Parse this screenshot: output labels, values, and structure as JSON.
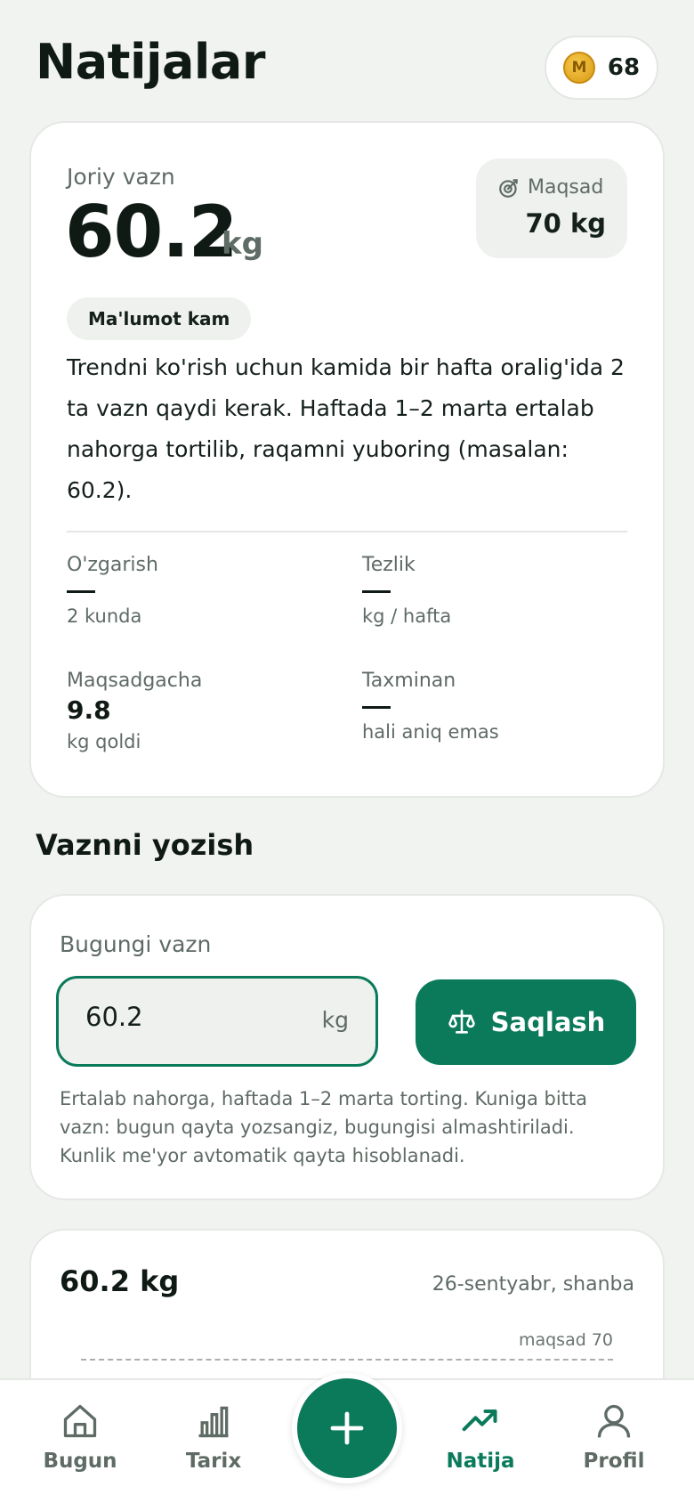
{
  "header": {
    "title": "Natijalar",
    "coin_symbol": "M",
    "coins": "68"
  },
  "current": {
    "label": "Joriy vazn",
    "value": "60.2",
    "unit": "kg",
    "goal_label": "Maqsad",
    "goal_value": "70 kg",
    "badge": "Ma'lumot kam",
    "hint": "Trendni ko'rish uchun kamida bir hafta oralig'ida 2 ta vazn qaydi kerak. Haftada 1–2 marta ertalab nahorga tortilib, raqamni yuboring (masalan: 60.2).",
    "stats": {
      "change_label": "O'zgarish",
      "change_sub": "2 kunda",
      "speed_label": "Tezlik",
      "speed_sub": "kg / hafta",
      "to_goal_label": "Maqsadgacha",
      "to_goal_value": "9.8",
      "to_goal_sub": "kg qoldi",
      "eta_label": "Taxminan",
      "eta_sub": "hali aniq emas"
    }
  },
  "log": {
    "section_title": "Vaznni yozish",
    "label": "Bugungi vazn",
    "input_value": "60.2",
    "unit": "kg",
    "save_label": "Saqlash",
    "hint": "Ertalab nahorga, haftada 1–2 marta torting. Kuniga bitta vazn: bugun qayta yozsangiz, bugungisi almashtiriladi. Kunlik me'yor avtomatik qayta hisoblanadi."
  },
  "chart": {
    "weight": "60.2 kg",
    "date": "26-sentyabr, shanba",
    "goal_line_label": "maqsad 70"
  },
  "nav": {
    "bugun": "Bugun",
    "tarix": "Tarix",
    "natija": "Natija",
    "profil": "Profil"
  },
  "colors": {
    "accent": "#0b7a5a",
    "background": "#f1f3f1",
    "coin": "#e8b12a"
  }
}
